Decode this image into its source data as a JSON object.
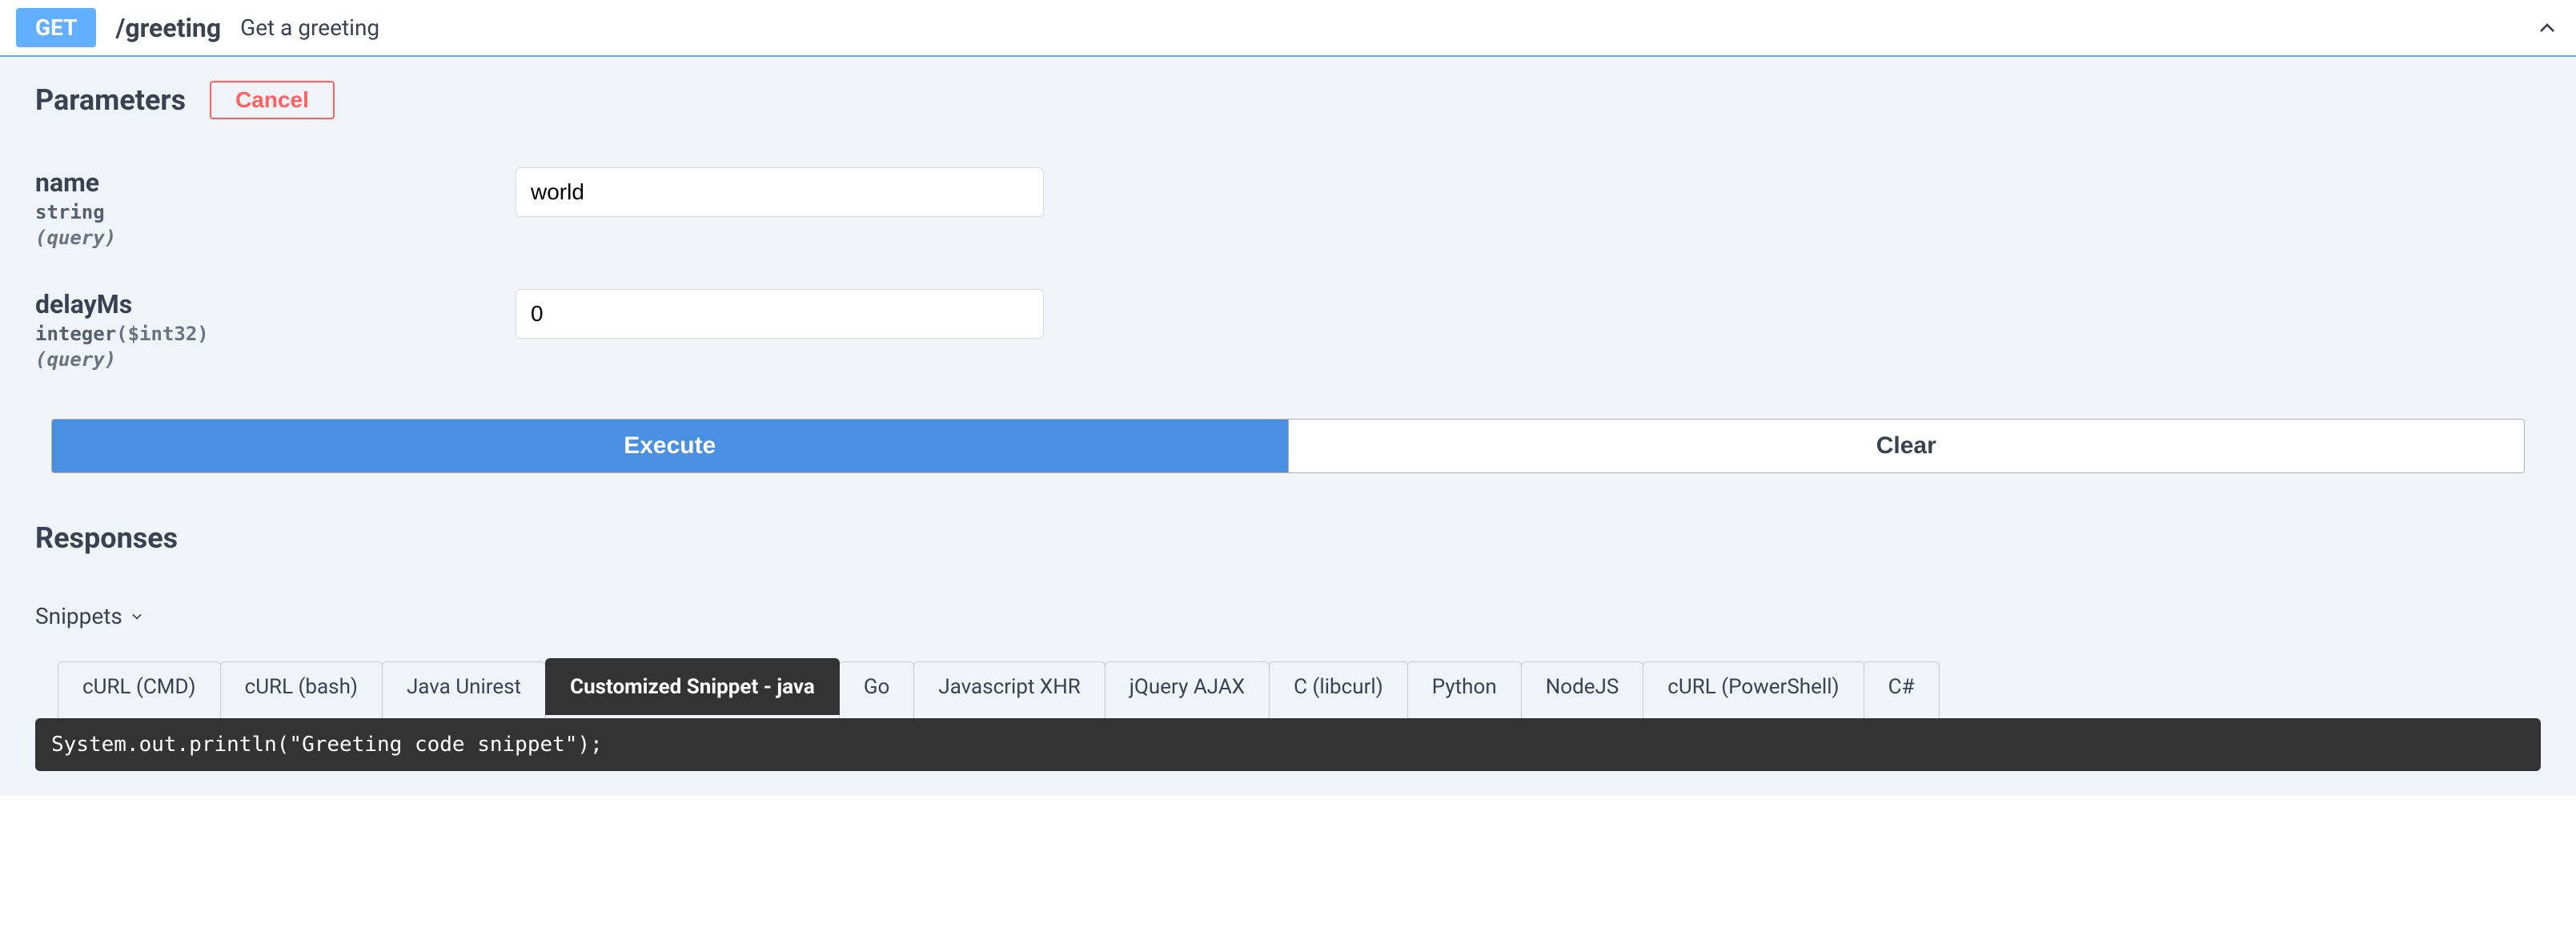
{
  "header": {
    "method": "GET",
    "path": "/greeting",
    "description": "Get a greeting"
  },
  "parameters": {
    "title": "Parameters",
    "cancel_label": "Cancel",
    "items": [
      {
        "name": "name",
        "type": "string",
        "format": "",
        "in": "(query)",
        "value": "world"
      },
      {
        "name": "delayMs",
        "type": "integer",
        "format": "($int32)",
        "in": "(query)",
        "value": "0"
      }
    ]
  },
  "actions": {
    "execute_label": "Execute",
    "clear_label": "Clear"
  },
  "responses": {
    "title": "Responses",
    "snippets_label": "Snippets",
    "tabs": [
      "cURL (CMD)",
      "cURL (bash)",
      "Java Unirest",
      "Customized Snippet - java",
      "Go",
      "Javascript XHR",
      "jQuery AJAX",
      "C (libcurl)",
      "Python",
      "NodeJS",
      "cURL (PowerShell)",
      "C#"
    ],
    "active_tab_index": 3,
    "code": "System.out.println(\"Greeting code snippet\");"
  }
}
